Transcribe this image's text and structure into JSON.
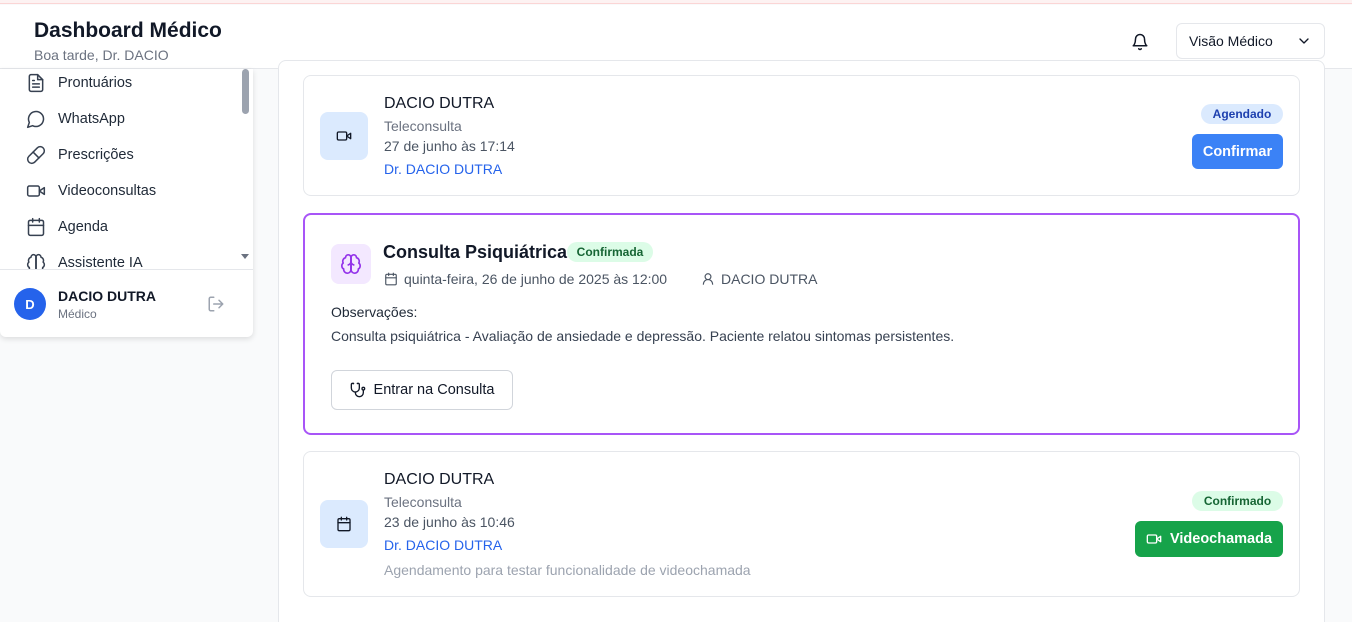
{
  "header": {
    "title": "Dashboard Médico",
    "subtitle": "Boa tarde, Dr. DACIO",
    "view_select": "Visão Médico"
  },
  "sidebar": {
    "items": [
      {
        "label": "Prontuários",
        "icon": "file-text-icon"
      },
      {
        "label": "WhatsApp",
        "icon": "message-circle-icon"
      },
      {
        "label": "Prescrições",
        "icon": "pill-icon"
      },
      {
        "label": "Videoconsultas",
        "icon": "video-icon"
      },
      {
        "label": "Agenda",
        "icon": "calendar-icon"
      },
      {
        "label": "Assistente IA",
        "icon": "brain-icon"
      }
    ],
    "user": {
      "initial": "D",
      "name": "DACIO DUTRA",
      "role": "Médico"
    }
  },
  "appointments": [
    {
      "patient": "DACIO DUTRA",
      "type": "Teleconsulta",
      "datetime": "27 de junho às 17:14",
      "doctor": "Dr. DACIO DUTRA",
      "status": "Agendado",
      "action": "Confirmar",
      "icon": "video-icon"
    },
    {
      "title": "Consulta Psiquiátrica",
      "status": "Confirmada",
      "datetime": "quinta-feira, 26 de junho de 2025 às 12:00",
      "patient": "DACIO DUTRA",
      "obs_label": "Observações:",
      "obs_text": "Consulta psiquiátrica - Avaliação de ansiedade e depressão. Paciente relatou sintomas persistentes.",
      "action": "Entrar na Consulta",
      "icon": "brain-icon"
    },
    {
      "patient": "DACIO DUTRA",
      "type": "Teleconsulta",
      "datetime": "23 de junho às 10:46",
      "doctor": "Dr. DACIO DUTRA",
      "note": "Agendamento para testar funcionalidade de videochamada",
      "status": "Confirmado",
      "action": "Videochamada",
      "icon": "calendar-icon"
    }
  ],
  "colors": {
    "primary_blue": "#3b82f6",
    "success_green": "#16a34a",
    "purple_border": "#a855f7"
  }
}
